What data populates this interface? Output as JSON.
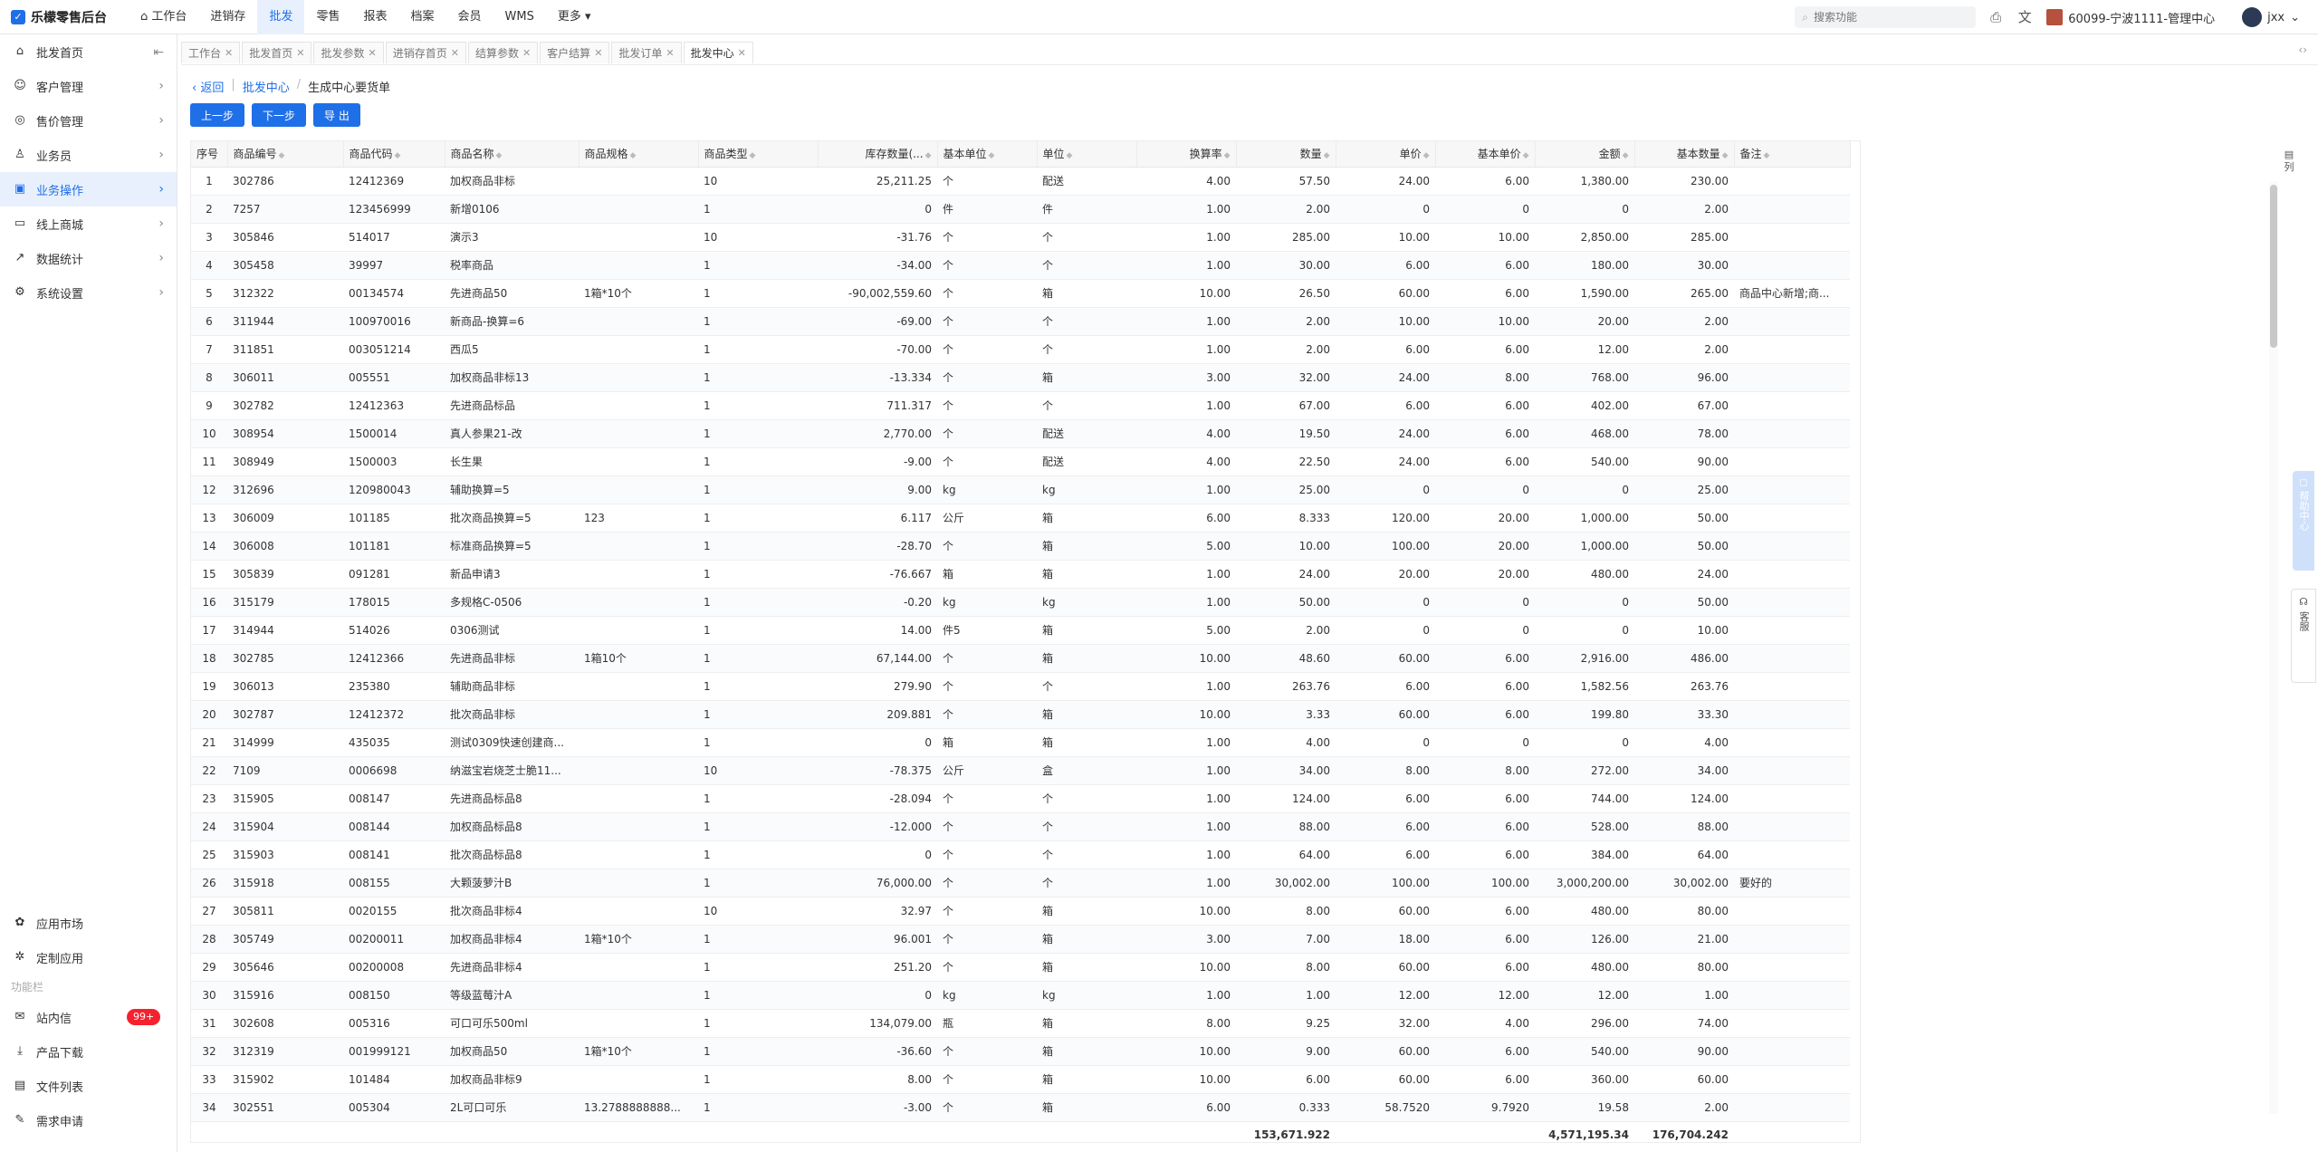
{
  "app": {
    "title": "乐檬零售后台"
  },
  "topnav": [
    "工作台",
    "进销存",
    "批发",
    "零售",
    "报表",
    "档案",
    "会员",
    "WMS",
    "更多"
  ],
  "topnav_active": 2,
  "search": {
    "placeholder": "搜索功能"
  },
  "store": "60099-宁波1111-管理中心",
  "user": "jxx",
  "sidebar": {
    "items": [
      "批发首页",
      "客户管理",
      "售价管理",
      "业务员",
      "业务操作",
      "线上商城",
      "数据统计",
      "系统设置"
    ],
    "active": 4,
    "bottom": [
      "应用市场",
      "定制应用"
    ],
    "group_label": "功能栏",
    "tools": [
      "站内信",
      "产品下载",
      "文件列表",
      "需求申请"
    ],
    "msg_badge": "99+"
  },
  "tabs": [
    "工作台",
    "批发首页",
    "批发参数",
    "进销存首页",
    "结算参数",
    "客户结算",
    "批发订单",
    "批发中心"
  ],
  "tabs_active": 7,
  "breadcrumb": {
    "back": "返回",
    "parent": "批发中心",
    "current": "生成中心要货单"
  },
  "actions": {
    "prev": "上一步",
    "next": "下一步",
    "export": "导 出"
  },
  "columns": [
    "序号",
    "商品编号",
    "商品代码",
    "商品名称",
    "商品规格",
    "商品类型",
    "库存数量(...",
    "基本单位",
    "单位",
    "换算率",
    "数量",
    "单价",
    "基本单价",
    "金额",
    "基本数量",
    "备注"
  ],
  "rows": [
    [
      "1",
      "302786",
      "12412369",
      "加权商品非标",
      "",
      "10",
      "25,211.25",
      "个",
      "配送",
      "4.00",
      "57.50",
      "24.00",
      "6.00",
      "1,380.00",
      "230.00",
      ""
    ],
    [
      "2",
      "7257",
      "123456999",
      "新增0106",
      "",
      "1",
      "0",
      "件",
      "件",
      "1.00",
      "2.00",
      "0",
      "0",
      "0",
      "2.00",
      ""
    ],
    [
      "3",
      "305846",
      "514017",
      "演示3",
      "",
      "10",
      "-31.76",
      "个",
      "个",
      "1.00",
      "285.00",
      "10.00",
      "10.00",
      "2,850.00",
      "285.00",
      ""
    ],
    [
      "4",
      "305458",
      "39997",
      "税率商品",
      "",
      "1",
      "-34.00",
      "个",
      "个",
      "1.00",
      "30.00",
      "6.00",
      "6.00",
      "180.00",
      "30.00",
      ""
    ],
    [
      "5",
      "312322",
      "00134574",
      "先进商品50",
      "1箱*10个",
      "1",
      "-90,002,559.60",
      "个",
      "箱",
      "10.00",
      "26.50",
      "60.00",
      "6.00",
      "1,590.00",
      "265.00",
      "商品中心新增;商..."
    ],
    [
      "6",
      "311944",
      "100970016",
      "新商品-换算=6",
      "",
      "1",
      "-69.00",
      "个",
      "个",
      "1.00",
      "2.00",
      "10.00",
      "10.00",
      "20.00",
      "2.00",
      ""
    ],
    [
      "7",
      "311851",
      "003051214",
      "西瓜5",
      "",
      "1",
      "-70.00",
      "个",
      "个",
      "1.00",
      "2.00",
      "6.00",
      "6.00",
      "12.00",
      "2.00",
      ""
    ],
    [
      "8",
      "306011",
      "005551",
      "加权商品非标13",
      "",
      "1",
      "-13.334",
      "个",
      "箱",
      "3.00",
      "32.00",
      "24.00",
      "8.00",
      "768.00",
      "96.00",
      ""
    ],
    [
      "9",
      "302782",
      "12412363",
      "先进商品标品",
      "",
      "1",
      "711.317",
      "个",
      "个",
      "1.00",
      "67.00",
      "6.00",
      "6.00",
      "402.00",
      "67.00",
      ""
    ],
    [
      "10",
      "308954",
      "1500014",
      "真人参果21-改",
      "",
      "1",
      "2,770.00",
      "个",
      "配送",
      "4.00",
      "19.50",
      "24.00",
      "6.00",
      "468.00",
      "78.00",
      ""
    ],
    [
      "11",
      "308949",
      "1500003",
      "长生果",
      "",
      "1",
      "-9.00",
      "个",
      "配送",
      "4.00",
      "22.50",
      "24.00",
      "6.00",
      "540.00",
      "90.00",
      ""
    ],
    [
      "12",
      "312696",
      "120980043",
      "辅助换算=5",
      "",
      "1",
      "9.00",
      "kg",
      "kg",
      "1.00",
      "25.00",
      "0",
      "0",
      "0",
      "25.00",
      ""
    ],
    [
      "13",
      "306009",
      "101185",
      "批次商品换算=5",
      "123",
      "1",
      "6.117",
      "公斤",
      "箱",
      "6.00",
      "8.333",
      "120.00",
      "20.00",
      "1,000.00",
      "50.00",
      ""
    ],
    [
      "14",
      "306008",
      "101181",
      "标准商品换算=5",
      "",
      "1",
      "-28.70",
      "个",
      "箱",
      "5.00",
      "10.00",
      "100.00",
      "20.00",
      "1,000.00",
      "50.00",
      ""
    ],
    [
      "15",
      "305839",
      "091281",
      "新品申请3",
      "",
      "1",
      "-76.667",
      "箱",
      "箱",
      "1.00",
      "24.00",
      "20.00",
      "20.00",
      "480.00",
      "24.00",
      ""
    ],
    [
      "16",
      "315179",
      "178015",
      "多规格C-0506",
      "",
      "1",
      "-0.20",
      "kg",
      "kg",
      "1.00",
      "50.00",
      "0",
      "0",
      "0",
      "50.00",
      ""
    ],
    [
      "17",
      "314944",
      "514026",
      "0306测试",
      "",
      "1",
      "14.00",
      "件5",
      "箱",
      "5.00",
      "2.00",
      "0",
      "0",
      "0",
      "10.00",
      ""
    ],
    [
      "18",
      "302785",
      "12412366",
      "先进商品非标",
      "1箱10个",
      "1",
      "67,144.00",
      "个",
      "箱",
      "10.00",
      "48.60",
      "60.00",
      "6.00",
      "2,916.00",
      "486.00",
      ""
    ],
    [
      "19",
      "306013",
      "235380",
      "辅助商品非标",
      "",
      "1",
      "279.90",
      "个",
      "个",
      "1.00",
      "263.76",
      "6.00",
      "6.00",
      "1,582.56",
      "263.76",
      ""
    ],
    [
      "20",
      "302787",
      "12412372",
      "批次商品非标",
      "",
      "1",
      "209.881",
      "个",
      "箱",
      "10.00",
      "3.33",
      "60.00",
      "6.00",
      "199.80",
      "33.30",
      ""
    ],
    [
      "21",
      "314999",
      "435035",
      "测试0309快速创建商...",
      "",
      "1",
      "0",
      "箱",
      "箱",
      "1.00",
      "4.00",
      "0",
      "0",
      "0",
      "4.00",
      ""
    ],
    [
      "22",
      "7109",
      "0006698",
      "纳滋宝岩烧芝士脆11...",
      "",
      "10",
      "-78.375",
      "公斤",
      "盒",
      "1.00",
      "34.00",
      "8.00",
      "8.00",
      "272.00",
      "34.00",
      ""
    ],
    [
      "23",
      "315905",
      "008147",
      "先进商品标品8",
      "",
      "1",
      "-28.094",
      "个",
      "个",
      "1.00",
      "124.00",
      "6.00",
      "6.00",
      "744.00",
      "124.00",
      ""
    ],
    [
      "24",
      "315904",
      "008144",
      "加权商品标品8",
      "",
      "1",
      "-12.000",
      "个",
      "个",
      "1.00",
      "88.00",
      "6.00",
      "6.00",
      "528.00",
      "88.00",
      ""
    ],
    [
      "25",
      "315903",
      "008141",
      "批次商品标品8",
      "",
      "1",
      "0",
      "个",
      "个",
      "1.00",
      "64.00",
      "6.00",
      "6.00",
      "384.00",
      "64.00",
      ""
    ],
    [
      "26",
      "315918",
      "008155",
      "大颗菠萝汁B",
      "",
      "1",
      "76,000.00",
      "个",
      "个",
      "1.00",
      "30,002.00",
      "100.00",
      "100.00",
      "3,000,200.00",
      "30,002.00",
      "要好的"
    ],
    [
      "27",
      "305811",
      "0020155",
      "批次商品非标4",
      "",
      "10",
      "32.97",
      "个",
      "箱",
      "10.00",
      "8.00",
      "60.00",
      "6.00",
      "480.00",
      "80.00",
      ""
    ],
    [
      "28",
      "305749",
      "00200011",
      "加权商品非标4",
      "1箱*10个",
      "1",
      "96.001",
      "个",
      "箱",
      "3.00",
      "7.00",
      "18.00",
      "6.00",
      "126.00",
      "21.00",
      ""
    ],
    [
      "29",
      "305646",
      "00200008",
      "先进商品非标4",
      "",
      "1",
      "251.20",
      "个",
      "箱",
      "10.00",
      "8.00",
      "60.00",
      "6.00",
      "480.00",
      "80.00",
      ""
    ],
    [
      "30",
      "315916",
      "008150",
      "等级蓝莓汁A",
      "",
      "1",
      "0",
      "kg",
      "kg",
      "1.00",
      "1.00",
      "12.00",
      "12.00",
      "12.00",
      "1.00",
      ""
    ],
    [
      "31",
      "302608",
      "005316",
      "可口可乐500ml",
      "",
      "1",
      "134,079.00",
      "瓶",
      "箱",
      "8.00",
      "9.25",
      "32.00",
      "4.00",
      "296.00",
      "74.00",
      ""
    ],
    [
      "32",
      "312319",
      "001999121",
      "加权商品50",
      "1箱*10个",
      "1",
      "-36.60",
      "个",
      "箱",
      "10.00",
      "9.00",
      "60.00",
      "6.00",
      "540.00",
      "90.00",
      ""
    ],
    [
      "33",
      "315902",
      "101484",
      "加权商品非标9",
      "",
      "1",
      "8.00",
      "个",
      "箱",
      "10.00",
      "6.00",
      "60.00",
      "6.00",
      "360.00",
      "60.00",
      ""
    ],
    [
      "34",
      "302551",
      "005304",
      "2L可口可乐",
      "13.2788888888...",
      "1",
      "-3.00",
      "个",
      "箱",
      "6.00",
      "0.333",
      "58.7520",
      "9.7920",
      "19.58",
      "2.00",
      ""
    ]
  ],
  "totals": {
    "qty": "153,671.922",
    "amount": "4,571,195.34",
    "base_qty": "176,704.242"
  },
  "side_right": {
    "columns": "列",
    "help": "帮助中心",
    "service": "客服"
  }
}
